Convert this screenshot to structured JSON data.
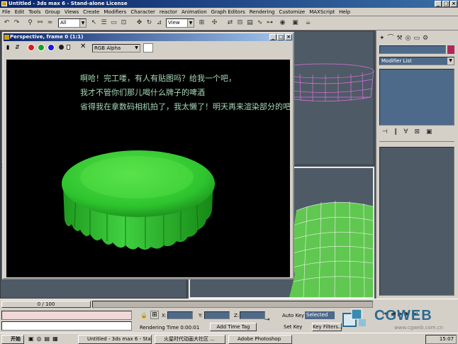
{
  "app": {
    "title": "Untitled - 3ds max 6 - Stand-alone License",
    "min_btn": "_",
    "max_btn": "□",
    "close_btn": "×"
  },
  "menu": [
    "File",
    "Edit",
    "Tools",
    "Group",
    "Views",
    "Create",
    "Modifiers",
    "Character",
    "reactor",
    "Animation",
    "Graph Editors",
    "Rendering",
    "Customize",
    "MAXScript",
    "Help"
  ],
  "toolbar": {
    "view_select": "View",
    "view_select2": "View",
    "selection_filter": "All"
  },
  "render_window": {
    "title": "Perspective, frame 0 (1:1)",
    "channel_select": "RGB Alpha",
    "dropdown_arrow": "▼",
    "clear_icon": "✕",
    "caption_lines": [
      "啊哈！完工喽，有人有贴图吗？给我一个吧，",
      "我才不管你们那儿喝什么牌子的啤酒",
      "省得我在拿数码相机拍了，我太懒了！明天再来渲染部分的吧~拜拜！^_^zZ"
    ]
  },
  "command_panel": {
    "modifier_list": "Modifier List"
  },
  "timeline": {
    "frame_counter": "0 / 100"
  },
  "status": {
    "x_label": "X:",
    "y_label": "Y:",
    "z_label": "Z:",
    "rendering_time": "Rendering Time  0:00:01",
    "add_time_tag": "Add Time Tag",
    "auto_key": "Auto Key",
    "selected": "Selected",
    "set_key": "Set Key",
    "key_filters": "Key Filters..."
  },
  "watermark": {
    "logo": "CGWEB",
    "url": "www.cgweb.com.cn"
  },
  "taskbar": {
    "start": "开始",
    "items": [
      "Untitled - 3ds max 6 - Sta...",
      "火星时代动画大社区 ...",
      "Adobe Photoshop"
    ],
    "clock": "15:07"
  },
  "colors": {
    "title_bar": "#0a246a",
    "chrome": "#d4d0c8",
    "viewport_bg": "#4e5a66",
    "cap_green": "#2ec42e",
    "wire_magenta": "#e070e0",
    "caption_text": "#a8d8b8"
  }
}
